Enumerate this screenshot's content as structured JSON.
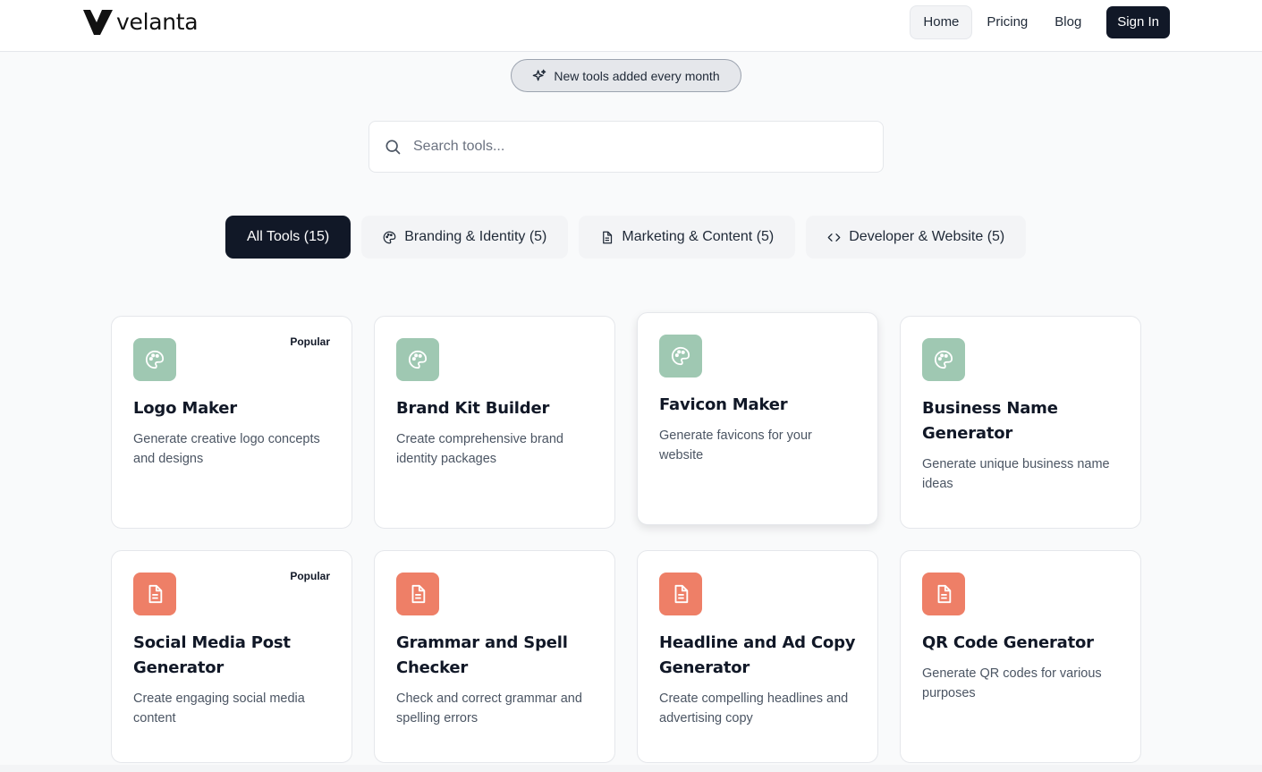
{
  "brand": {
    "name": "velanta"
  },
  "nav": {
    "items": [
      "Home",
      "Pricing",
      "Blog"
    ],
    "sign_in": "Sign In"
  },
  "badge": {
    "label": "New tools added every month"
  },
  "search": {
    "placeholder": "Search tools..."
  },
  "tabs": [
    {
      "label": "All Tools (15)",
      "active": true
    },
    {
      "label": "Branding & Identity (5)",
      "icon": "palette-icon"
    },
    {
      "label": "Marketing & Content (5)",
      "icon": "document-icon"
    },
    {
      "label": "Developer & Website (5)",
      "icon": "code-icon"
    }
  ],
  "cards": [
    {
      "title": "Logo Maker",
      "description": "Generate creative logo concepts and designs",
      "badge": "Popular",
      "icon": "palette-icon",
      "color": "#9fc8b2"
    },
    {
      "title": "Brand Kit Builder",
      "description": "Create comprehensive brand identity packages",
      "icon": "palette-icon",
      "color": "#9fc8b2"
    },
    {
      "title": "Favicon Maker",
      "description": "Generate favicons for your website",
      "icon": "palette-icon",
      "color": "#9fc8b2"
    },
    {
      "title": "Business Name Generator",
      "description": "Generate unique business name ideas",
      "icon": "palette-icon",
      "color": "#9fc8b2"
    },
    {
      "title": "Social Media Post Generator",
      "description": "Create engaging social media content",
      "badge": "Popular",
      "icon": "document-icon",
      "color": "#ee7f67"
    },
    {
      "title": "Grammar and Spell Checker",
      "description": "Check and correct grammar and spelling errors",
      "icon": "document-icon",
      "color": "#ee7f67"
    },
    {
      "title": "Headline and Ad Copy Generator",
      "description": "Create compelling headlines and advertising copy",
      "icon": "document-icon",
      "color": "#ee7f67"
    },
    {
      "title": "QR Code Generator",
      "description": "Generate QR codes for various purposes",
      "icon": "document-icon",
      "color": "#ee7f67"
    }
  ]
}
